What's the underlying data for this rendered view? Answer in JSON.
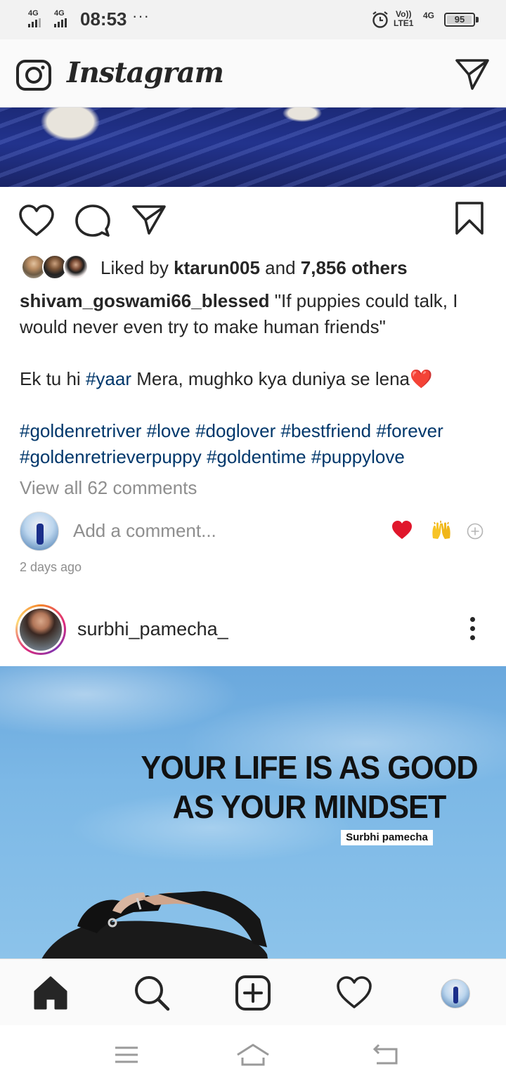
{
  "status_bar": {
    "signal_1": "4G",
    "signal_2": "4G",
    "time": "08:53",
    "more": "···",
    "volte_line1": "Vo))",
    "volte_line2": "LTE1",
    "network": "4G",
    "battery": "95"
  },
  "header": {
    "app_name": "Instagram"
  },
  "post1": {
    "liked_by_prefix": "Liked by",
    "liked_by_user": "ktarun005",
    "and_text": "and",
    "others_count": "7,856 others",
    "caption_user": "shivam_goswami66_blessed",
    "caption_text": "\"If puppies could talk, I would never even try to make human friends\"",
    "line2_before": "Ek tu hi",
    "line2_hashtag": "#yaar",
    "line2_after": "Mera,  mughko kya duniya se lena❤️",
    "hashtags": [
      "#goldenretriver",
      "#love",
      "#doglover",
      "#bestfriend",
      "#forever",
      "#goldenretrieverpuppy",
      "#goldentime",
      "#puppylove"
    ],
    "view_comments": "View all 62 comments",
    "comment_placeholder": "Add a comment...",
    "timestamp": "2 days ago"
  },
  "post2": {
    "username": "surbhi_pamecha_",
    "quote_line1": "YOUR LIFE IS AS GOOD",
    "quote_line2": "AS YOUR MINDSET",
    "signature": "Surbhi pamecha"
  },
  "bottom_nav": {
    "items": [
      "home",
      "search",
      "new-post",
      "activity",
      "profile"
    ]
  },
  "colors": {
    "hashtag": "#00376b",
    "secondary_text": "#8e8e8e",
    "primary_text": "#262626",
    "heart_red": "#e0162b"
  }
}
